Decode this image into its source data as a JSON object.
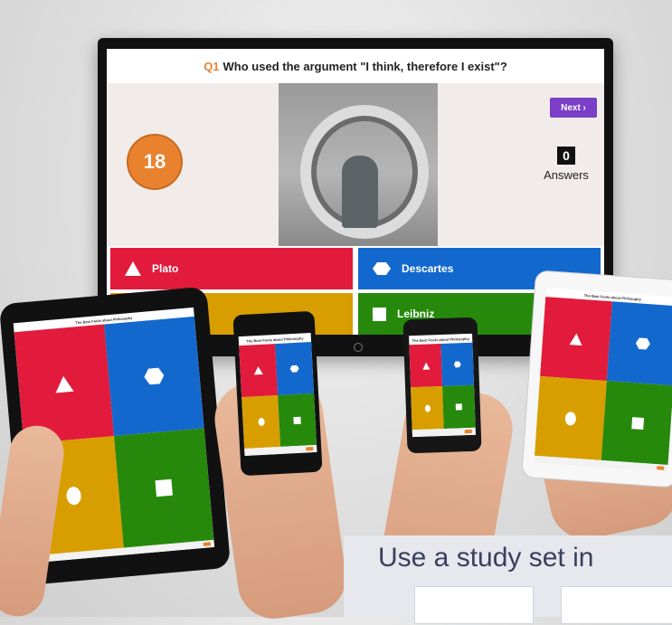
{
  "quiz": {
    "question_number": "Q1",
    "question_text": "Who used the argument \"I think, therefore I exist\"?",
    "timer": "18",
    "next_label": "Next ›",
    "answers_count": "0",
    "answers_label": "Answers",
    "options": [
      {
        "label": "Plato",
        "color": "#e21b3c",
        "shape": "triangle"
      },
      {
        "label": "Descartes",
        "color": "#1368ce",
        "shape": "hexagon"
      },
      {
        "label": "",
        "color": "#d89e00",
        "shape": "circle"
      },
      {
        "label": "Leibniz",
        "color": "#26890c",
        "shape": "square"
      }
    ]
  },
  "device_header": "The Best Fools about Philosophy",
  "banner": {
    "title": "Use a study set in"
  },
  "colors": {
    "red": "#e21b3c",
    "blue": "#1368ce",
    "yellow": "#d89e00",
    "green": "#26890c",
    "accent_orange": "#e8822f",
    "next_purple": "#7a3ec7"
  }
}
